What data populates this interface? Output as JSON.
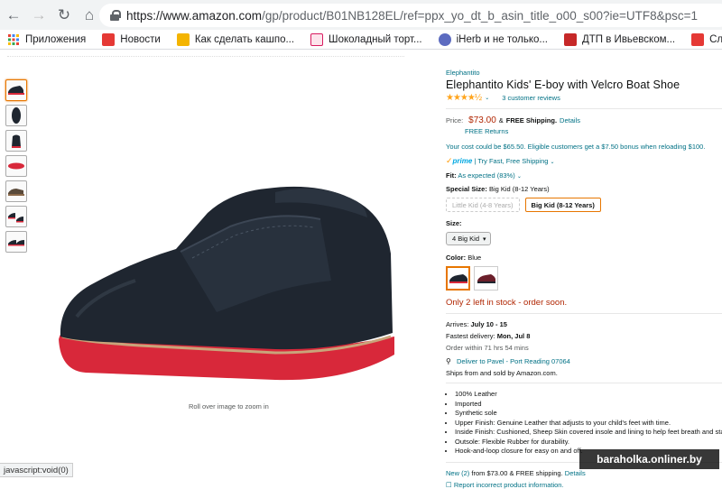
{
  "browser": {
    "url_host": "https://www.amazon.com",
    "url_path": "/gp/product/B01NB128EL/ref=ppx_yo_dt_b_asin_title_o00_s00?ie=UTF8&psc=1",
    "bookmarks": [
      {
        "label": "Приложения",
        "icon": "apps-grid-icon",
        "color": "#ea4335"
      },
      {
        "label": "Новости",
        "icon": "news-icon",
        "color": "#e53935"
      },
      {
        "label": "Как сделать кашпо...",
        "icon": "lm-icon",
        "color": "#f4b400"
      },
      {
        "label": "Шоколадный торт...",
        "icon": "cake-icon",
        "color": "#d81b60"
      },
      {
        "label": "iHerb и не только...",
        "icon": "user-icon",
        "color": "#5c6bc0"
      },
      {
        "label": "ДТП в Ивьевском...",
        "icon": "car-icon",
        "color": "#c62828"
      },
      {
        "label": "Случайные оптиче...",
        "icon": "info-icon",
        "color": "#e53935"
      }
    ]
  },
  "product": {
    "brand": "Elephantito",
    "title": "Elephantito Kids' E-boy with Velcro Boat Shoe",
    "stars": "★★★★½",
    "rating": 4.5,
    "reviews": "3 customer reviews",
    "price_label": "Price:",
    "price": "$73.00",
    "shipping_amp": "&",
    "free_shipping": "FREE Shipping.",
    "details": "Details",
    "free_returns": "FREE Returns",
    "promo": "Your cost could be $65.50. Eligible customers get a $7.50 bonus when reloading $100.",
    "prime": "prime",
    "prime_text": "| Try Fast, Free Shipping",
    "fit_label": "Fit:",
    "fit_value": "As expected (83%)",
    "special_size_label": "Special Size:",
    "special_size_value": "Big Kid (8-12 Years)",
    "size_options": [
      "Little Kid (4-8 Years)",
      "Big Kid (8-12 Years)"
    ],
    "size_label": "Size:",
    "size_value": "4 Big Kid",
    "color_label": "Color:",
    "color_value": "Blue",
    "stock": "Only 2 left in stock - order soon.",
    "arrives_label": "Arrives:",
    "arrives_value": "July 10 - 15",
    "fastest_label": "Fastest delivery:",
    "fastest_value": "Mon, Jul 8",
    "order_within": "Order within 71 hrs 54 mins",
    "deliver_to": "Deliver to Pavel - Port Reading 07064",
    "ships_from": "Ships from and sold by Amazon.com.",
    "bullets": [
      "100% Leather",
      "Imported",
      "Synthetic sole",
      "Upper Finish: Genuine Leather that adjusts to your child's feet with time.",
      "Inside Finish: Cushioned, Sheep Skin covered insole and lining to help feet breath and stay co",
      "Outsole: Flexible Rubber for durability.",
      "Hook-and-loop closure for easy on and off."
    ],
    "new_offer_prefix": "New",
    "new_offer_count": "(2)",
    "new_offer_suffix": "from $73.00 & FREE shipping.",
    "new_offer_details": "Details",
    "report": "Report incorrect product information.",
    "zoom_hint": "Roll over image to zoom in"
  },
  "colors": {
    "shoe_leather": "#1f2630",
    "sole_red": "#d8283a",
    "accent_orange": "#e77600",
    "price_red": "#b12704",
    "link_teal": "#007185"
  },
  "watermark": "baraholka.onliner.by",
  "status_bar": "javascript:void(0)"
}
